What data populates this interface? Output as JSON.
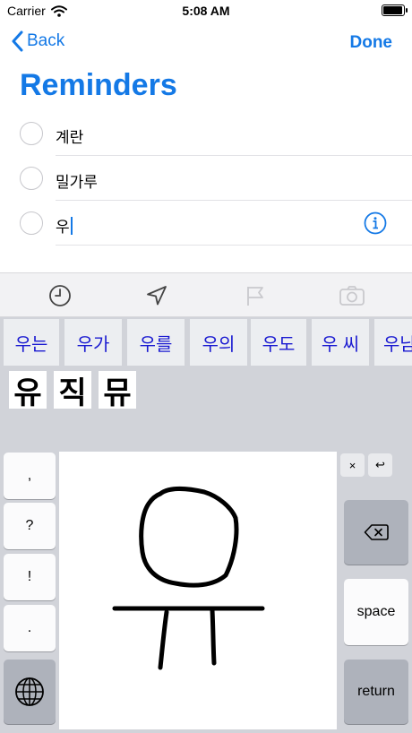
{
  "status_bar": {
    "carrier": "Carrier",
    "time": "5:08 AM",
    "battery_level": 0.95
  },
  "nav": {
    "back_label": "Back",
    "done_label": "Done"
  },
  "title": "Reminders",
  "reminders": [
    {
      "text": "계란"
    },
    {
      "text": "밀가루"
    },
    {
      "text": "우"
    }
  ],
  "toolbar": {
    "icons": [
      "clock-icon",
      "location-icon",
      "flag-icon",
      "camera-icon"
    ]
  },
  "candidates": [
    "우는",
    "우가",
    "우를",
    "우의",
    "우도",
    "우 씨",
    "우남"
  ],
  "suggestions": [
    "유",
    "직",
    "뮤"
  ],
  "keyboard": {
    "punctuation": [
      ",",
      "?",
      "!",
      "."
    ],
    "clear_label": "×",
    "undo_label": "↩",
    "space_label": "space",
    "return_label": "return"
  },
  "colors": {
    "accent": "#1479e6",
    "candidate_text": "#1a1ad1",
    "keyboard_bg": "#d1d3d9"
  }
}
